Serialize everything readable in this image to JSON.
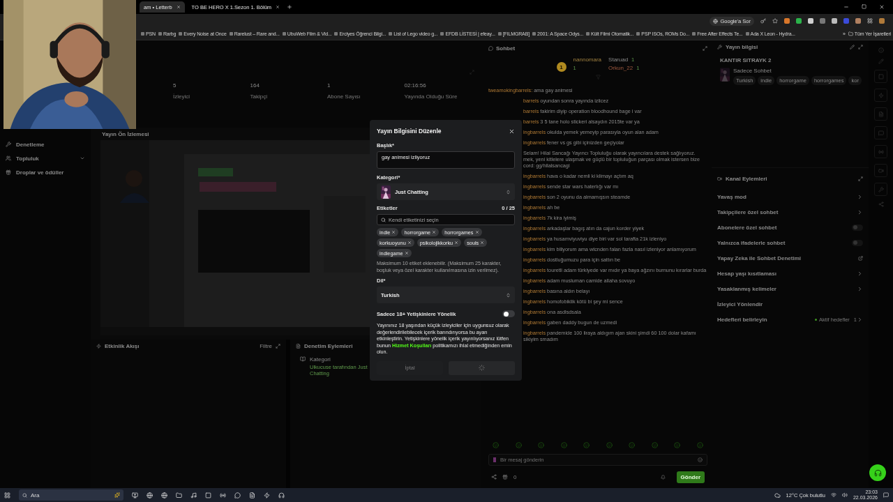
{
  "browser": {
    "tabs": [
      {
        "title": "am • Letterb",
        "selected": true
      },
      {
        "title": "TO BE HERO X 1.Sezon 1. Bölüm",
        "selected": false
      }
    ],
    "ask_google": "Google'a Sor",
    "bookmarks": [
      "PSN",
      "Rarbg",
      "Every Noise at Once",
      "Rarelust – Rare and...",
      "UbuWeb Film & Vid...",
      "Erciyes Öğrenci Bilgi...",
      "List of Lego video g...",
      "EFDB LİSTESİ | efeay...",
      "[FILMGRAB]",
      "2001: A Space Odys...",
      "Kült Filmi Otomatik...",
      "PSP ISOs, ROMs Do...",
      "Free After Effects Te...",
      "Ada X Leon - Hydra..."
    ],
    "more": "»",
    "all_bookmarks": "Tüm Yer İşaretleri"
  },
  "sidebar": {
    "items": [
      {
        "label": "Denetleme",
        "kind": "link"
      },
      {
        "label": "Topluluk",
        "kind": "group"
      },
      {
        "label": "Droplar ve ödüller",
        "kind": "link"
      }
    ]
  },
  "stats": [
    {
      "value": "5",
      "label": "İzleyici"
    },
    {
      "value": "164",
      "label": "Takipçi"
    },
    {
      "value": "1",
      "label": "Abone Sayısı"
    },
    {
      "value": "02:16:56",
      "label": "Yayında Olduğu Süre"
    }
  ],
  "preview": {
    "title": "Yayın Ön İzlemesi"
  },
  "activity": {
    "title": "Etkinlik Akışı",
    "filter": "Filtre"
  },
  "mod_actions": {
    "title": "Denetim Eylemleri",
    "entries": [
      {
        "title": "Kategori",
        "detail": "Ulkucuse tarafından Just Chatting"
      }
    ]
  },
  "chat": {
    "title": "Sohbet",
    "leader": {
      "rank": "1",
      "name": "nannomara",
      "count": "1"
    },
    "gifters": [
      {
        "name": "Staruad",
        "count": "1"
      },
      {
        "name": "Orkun_22",
        "count": "1"
      }
    ],
    "messages": [
      {
        "kind": "message",
        "covered": false,
        "user": "tweamokingbarrels:",
        "text": "ama gay animesi"
      },
      {
        "kind": "message",
        "covered": true,
        "user": "barrels",
        "text": "oyundan sonra yayında izlicez"
      },
      {
        "kind": "message",
        "covered": true,
        "user": "barrels",
        "text": "fakirim diyip operation bloodhound bage i var"
      },
      {
        "kind": "message",
        "covered": true,
        "user": "barrels",
        "text": "3 5 tane holo stickeri alsaydın 2015te var ya"
      },
      {
        "kind": "message",
        "covered": true,
        "user": "ingbarrels",
        "text": "okulda yemek yemeyip parasıyla oyun alan adam"
      },
      {
        "kind": "message",
        "covered": true,
        "user": "ingbarrels",
        "text": "fener vs gs gibi içinizden geçiyolar"
      },
      {
        "kind": "notice",
        "covered": true,
        "lines": [
          "Selam! Hilal Sancağı Yayıncı Topluluğu olarak yayıncılara destek sağlıyoruz.",
          "mek, yeni kitlelere ulaşmak ve güçlü bir topluluğun parçası olmak istersen bize",
          "cord: gg/hilalsancagi"
        ]
      },
      {
        "kind": "message",
        "covered": true,
        "user": "ingbarrels",
        "text": "hava o kadar nemli ki klimayı açtım aq"
      },
      {
        "kind": "message",
        "covered": true,
        "user": "ingbarrels",
        "text": "sende star wars haterlığı var mı"
      },
      {
        "kind": "message",
        "covered": true,
        "user": "ingbarrels",
        "text": "son 2 oyunu da almamışsın steamde"
      },
      {
        "kind": "message",
        "covered": true,
        "user": "ingbarrels",
        "text": "ah be"
      },
      {
        "kind": "message",
        "covered": true,
        "user": "ingbarrels",
        "text": "7k kira iyimiş"
      },
      {
        "kind": "message",
        "covered": true,
        "user": "ingbarrels",
        "text": "arkadaşlar bagış atın da cajun korder yiyek"
      },
      {
        "kind": "message",
        "covered": true,
        "user": "ingbarrels",
        "text": "ya husamviyuviyu diye biri var sol tarafta 21k izleniyo"
      },
      {
        "kind": "message",
        "covered": true,
        "user": "ingbarrels",
        "text": "kim biliyorum ama wtcnden falan fazla nasıl izleniyor anlamıyorum"
      },
      {
        "kind": "message",
        "covered": true,
        "user": "ingbarrels",
        "text": "dostluğumuzu para için sattın be"
      },
      {
        "kind": "message",
        "covered": true,
        "user": "ingbarrels",
        "text": "touretli adam türkiyede var mıdır ya baya ağzını burnunu kırarlar burda"
      },
      {
        "kind": "message",
        "covered": true,
        "user": "ingbarrels",
        "text": "adam musluman camide allaha sovuyo"
      },
      {
        "kind": "message",
        "covered": true,
        "user": "ingbarrels",
        "text": "basına aldın belayı"
      },
      {
        "kind": "message",
        "covered": true,
        "user": "ingbarrels",
        "text": "homofobiklik kötü bi şey mi sence"
      },
      {
        "kind": "message",
        "covered": true,
        "user": "ingbarrels",
        "text": "ona asdlsdsala"
      },
      {
        "kind": "message",
        "covered": true,
        "user": "ingbarrels",
        "text": "gaben daddy bugun de uzmedi"
      },
      {
        "kind": "message",
        "covered": true,
        "user": "ingbarrels",
        "text": "pandemide 100 liraya aldıgım ajan skini şimdi 60 100 dolar kafamı sikiyim smadım"
      }
    ],
    "input_placeholder": "Bir mesaj gönderin",
    "points": "0",
    "send": "Gönder"
  },
  "stream_info": {
    "title": "Yayın bilgisi",
    "stream_title": "KANTIR SITRAYK 2",
    "category": "Sadece Sohbet",
    "tags": [
      "Turkish",
      "indie",
      "horrorgame",
      "horrorgames",
      "kor"
    ]
  },
  "channel_actions": {
    "title": "Kanal Eylemleri",
    "items": [
      {
        "label": "Yavaş mod",
        "kind": "chevron"
      },
      {
        "label": "Takipçilere özel sohbet",
        "kind": "chevron"
      },
      {
        "label": "Abonelere özel sohbet",
        "kind": "toggle",
        "on": false
      },
      {
        "label": "Yalnızca ifadelerle sohbet",
        "kind": "toggle",
        "on": false
      },
      {
        "label": "Yapay Zeka ile Sohbet Denetimi",
        "kind": "external"
      },
      {
        "label": "Hesap yaşı kısıtlaması",
        "kind": "chevron"
      },
      {
        "label": "Yasaklanmış kelimeler",
        "kind": "chevron"
      },
      {
        "label": "İzleyici Yönlendir",
        "kind": "plain"
      },
      {
        "label": "Hedefleri belirleyin",
        "kind": "goal",
        "status": "Aktif hedefler",
        "count": "1"
      }
    ]
  },
  "modal": {
    "title": "Yayın Bilgisini Düzenle",
    "title_label": "Başlık*",
    "title_value": "gay animesi izliyoruz",
    "category_label": "Kategori*",
    "category": "Just Chatting",
    "tags_label": "Etiketler",
    "tags_count": "0 / 25",
    "tag_placeholder": "Kendi etiketinizi seçin",
    "tags": [
      "indie",
      "horrorgame",
      "horrorgames",
      "korkuoyunu",
      "psikolojikkorku",
      "souls",
      "indiegame"
    ],
    "tags_hint": "Maksimum 10 etiket eklenebilir. (Maksimum 25 karakter, boşluk veya özel karakter kullanılmasına izin verilmez).",
    "language_label": "Dil*",
    "language": "Turkish",
    "adult_label": "Sadece 18+ Yetişkinlere Yönelik",
    "adult_only": false,
    "adult_notice": "Yayınınız 18 yaşından küçük izleyiciler için uygunsuz olarak değerlendirilebilecek içerik barındırıyorsa bu ayarı etkinleştirin. Yetişkinlere yönelik içerik yayınlıyorsanız lütfen bunun ",
    "terms_link": "Hizmet Koşulları",
    "adult_notice_end": " politikamızı ihlal etmediğinden emin olun.",
    "cancel": "İptal",
    "saving": true
  },
  "taskbar": {
    "search": "Ara",
    "weather": "12°C Çok bulutlu",
    "time": "23:03",
    "date": "22.03.2026"
  }
}
